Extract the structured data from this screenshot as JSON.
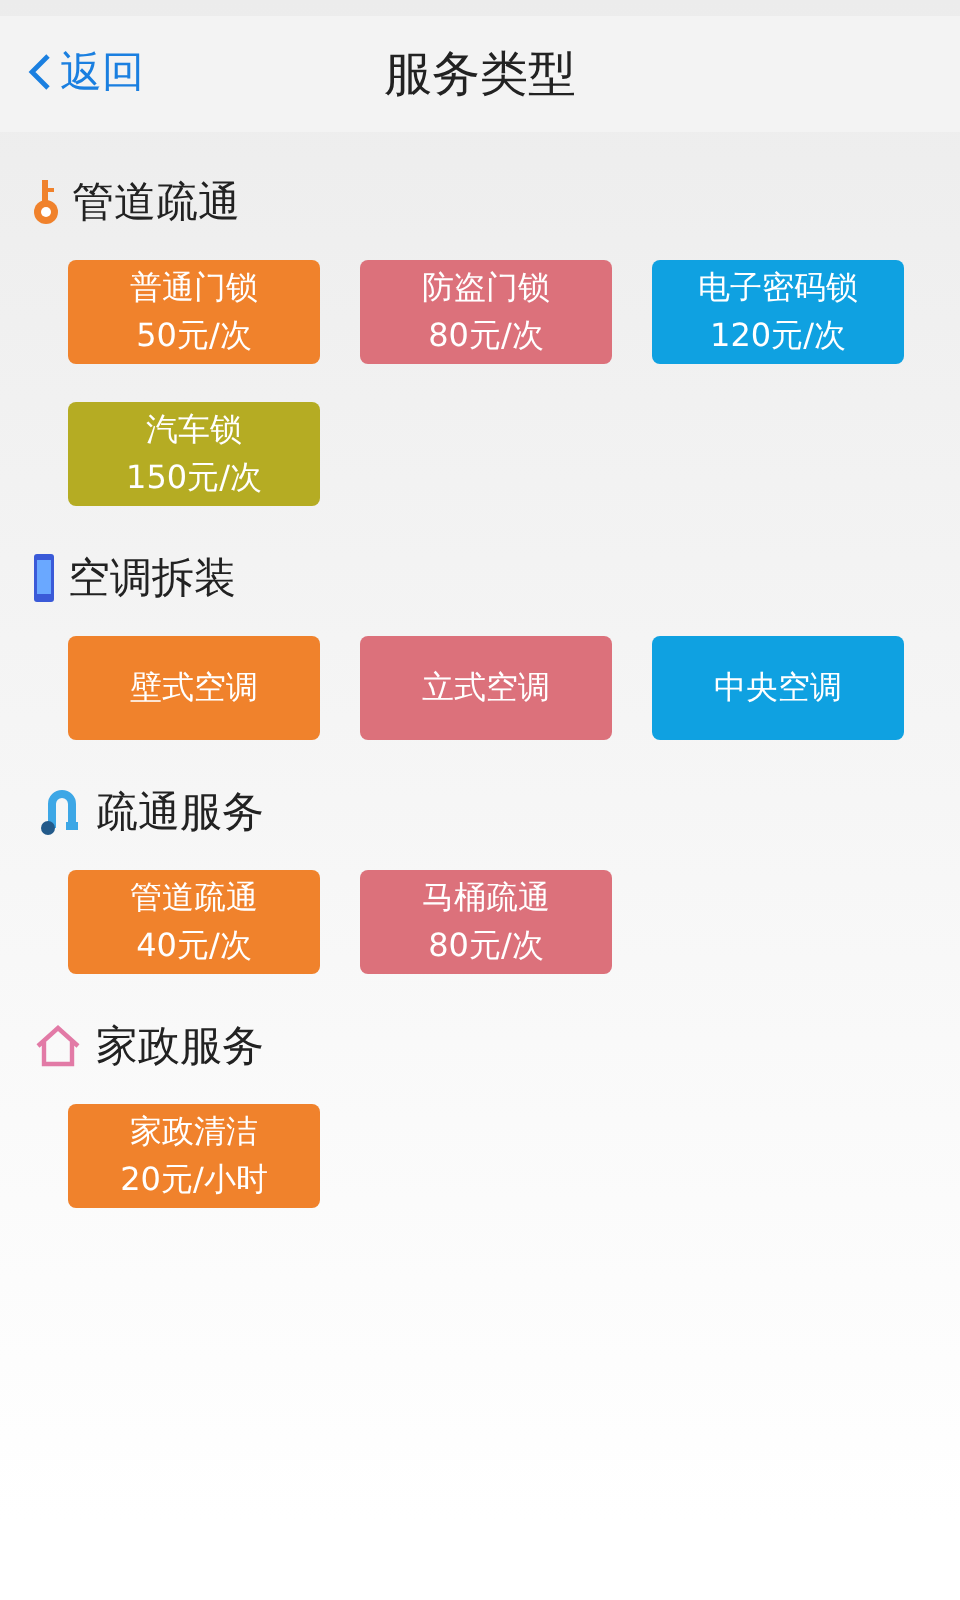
{
  "header": {
    "back": "返回",
    "title": "服务类型"
  },
  "sections": [
    {
      "title": "管道疏通",
      "kind": "key",
      "items": [
        {
          "name": "普通门锁",
          "price": "50元/次",
          "color": "#f0822c"
        },
        {
          "name": "防盗门锁",
          "price": "80元/次",
          "color": "#dc717b"
        },
        {
          "name": "电子密码锁",
          "price": "120元/次",
          "color": "#0fa1e1"
        },
        {
          "name": "汽车锁",
          "price": "150元/次",
          "color": "#b5ac23"
        }
      ]
    },
    {
      "title": "空调拆装",
      "kind": "phone",
      "items": [
        {
          "name": "壁式空调",
          "color": "#f0822c"
        },
        {
          "name": "立式空调",
          "color": "#dc717b"
        },
        {
          "name": "中央空调",
          "color": "#0fa1e1"
        }
      ]
    },
    {
      "title": "疏通服务",
      "kind": "pipe",
      "items": [
        {
          "name": "管道疏通",
          "price": "40元/次",
          "color": "#f0822c"
        },
        {
          "name": "马桶疏通",
          "price": "80元/次",
          "color": "#dc717b"
        }
      ]
    },
    {
      "title": "家政服务",
      "kind": "house",
      "items": [
        {
          "name": "家政清洁",
          "price": "20元/小时",
          "color": "#f0822c"
        }
      ]
    }
  ]
}
